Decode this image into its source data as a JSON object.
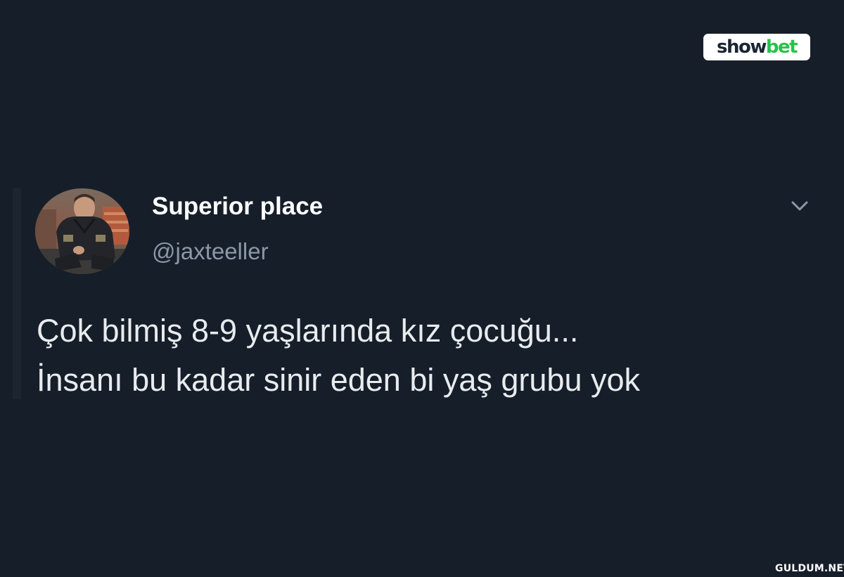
{
  "brand_logo": {
    "part_1": "show",
    "part_2": "bet",
    "colors": {
      "background": "#ffffff",
      "part_1": "#1b2533",
      "part_2": "#27c24c"
    }
  },
  "tweet": {
    "author": {
      "display_name": "Superior place",
      "handle": "@jaxteeller",
      "avatar": "profile-photo"
    },
    "more_icon": "chevron-down-icon",
    "text_lines": [
      "Çok bilmiş 8-9 yaşlarında kız çocuğu...",
      "İnsanı bu kadar sinir eden bi yaş grubu yok"
    ]
  },
  "watermark": {
    "text": "GULDUM.NET"
  },
  "colors": {
    "background": "#161e29",
    "name": "#ffffff",
    "handle": "#8b98a5",
    "body_text": "#e8ecef",
    "icon": "#8b98a5"
  }
}
